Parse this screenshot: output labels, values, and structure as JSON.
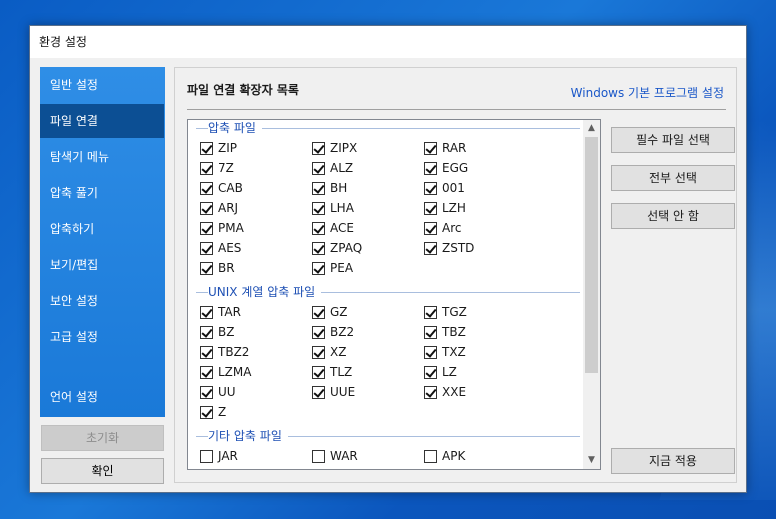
{
  "window": {
    "title": "환경 설정"
  },
  "sidebar": {
    "items": [
      {
        "label": "일반 설정"
      },
      {
        "label": "파일 연결"
      },
      {
        "label": "탐색기 메뉴"
      },
      {
        "label": "압축 풀기"
      },
      {
        "label": "압축하기"
      },
      {
        "label": "보기/편집"
      },
      {
        "label": "보안 설정"
      },
      {
        "label": "고급 설정"
      },
      {
        "label": "언어 설정"
      }
    ],
    "active_label": "파일 연결",
    "reset_label": "초기화",
    "ok_label": "확인"
  },
  "panel": {
    "title": "파일 연결 확장자 목록",
    "windows_link": "Windows 기본 프로그램 설정"
  },
  "groups": [
    {
      "title": "압축 파일",
      "items": [
        {
          "label": "ZIP",
          "checked": true
        },
        {
          "label": "ZIPX",
          "checked": true
        },
        {
          "label": "RAR",
          "checked": true
        },
        {
          "label": "7Z",
          "checked": true
        },
        {
          "label": "ALZ",
          "checked": true
        },
        {
          "label": "EGG",
          "checked": true
        },
        {
          "label": "CAB",
          "checked": true
        },
        {
          "label": "BH",
          "checked": true
        },
        {
          "label": "001",
          "checked": true
        },
        {
          "label": "ARJ",
          "checked": true
        },
        {
          "label": "LHA",
          "checked": true
        },
        {
          "label": "LZH",
          "checked": true
        },
        {
          "label": "PMA",
          "checked": true
        },
        {
          "label": "ACE",
          "checked": true
        },
        {
          "label": "Arc",
          "checked": true
        },
        {
          "label": "AES",
          "checked": true
        },
        {
          "label": "ZPAQ",
          "checked": true
        },
        {
          "label": "ZSTD",
          "checked": true
        },
        {
          "label": "BR",
          "checked": true
        },
        {
          "label": "PEA",
          "checked": true
        }
      ]
    },
    {
      "title": "UNIX 계열 압축 파일",
      "items": [
        {
          "label": "TAR",
          "checked": true
        },
        {
          "label": "GZ",
          "checked": true
        },
        {
          "label": "TGZ",
          "checked": true
        },
        {
          "label": "BZ",
          "checked": true
        },
        {
          "label": "BZ2",
          "checked": true
        },
        {
          "label": "TBZ",
          "checked": true
        },
        {
          "label": "TBZ2",
          "checked": true
        },
        {
          "label": "XZ",
          "checked": true
        },
        {
          "label": "TXZ",
          "checked": true
        },
        {
          "label": "LZMA",
          "checked": true
        },
        {
          "label": "TLZ",
          "checked": true
        },
        {
          "label": "LZ",
          "checked": true
        },
        {
          "label": "UU",
          "checked": true
        },
        {
          "label": "UUE",
          "checked": true
        },
        {
          "label": "XXE",
          "checked": true
        },
        {
          "label": "Z",
          "checked": true
        }
      ]
    },
    {
      "title": "기타 압축 파일",
      "items": [
        {
          "label": "JAR",
          "checked": false
        },
        {
          "label": "WAR",
          "checked": false
        },
        {
          "label": "APK",
          "checked": false
        }
      ]
    }
  ],
  "actions": {
    "select_required": "필수 파일 선택",
    "select_all": "전부 선택",
    "select_none": "선택 안 함",
    "apply_now": "지금 적용"
  },
  "colors": {
    "sidebar_bg": "#1a79d8",
    "sidebar_active": "#0c4f94",
    "group_header": "#1e50b4",
    "link": "#1a57c8"
  }
}
